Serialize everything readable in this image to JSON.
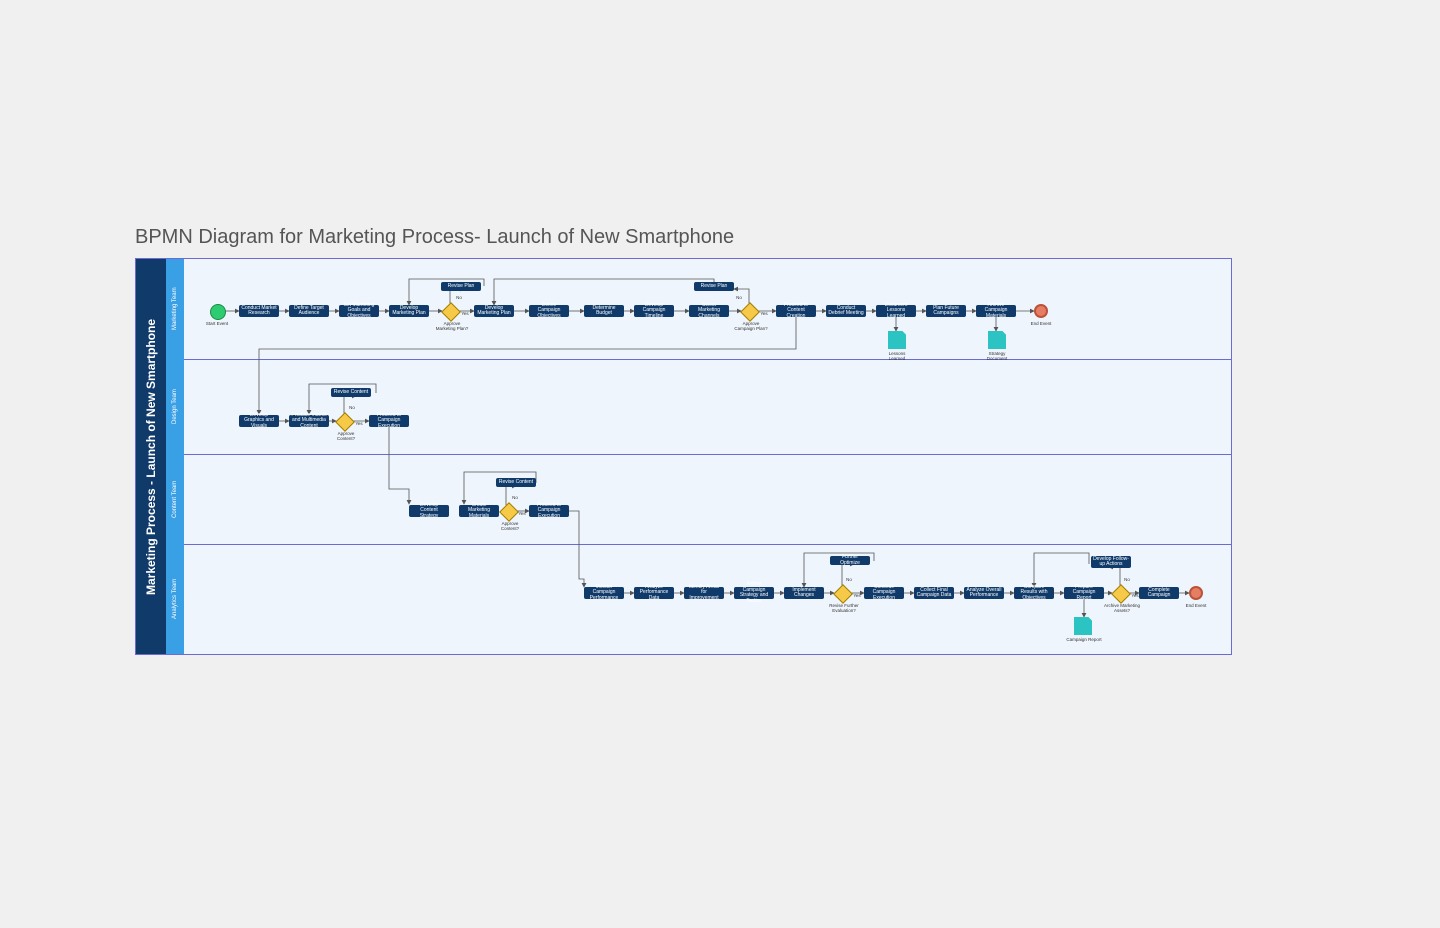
{
  "title": "BPMN Diagram for Marketing Process- Launch of New Smartphone",
  "pool_title": "Marketing Process - Launch of New Smartphone",
  "lanes": {
    "marketing": "Marketing Team",
    "design": "Design Team",
    "content": "Content Team",
    "analytics": "Analytics Team"
  },
  "events": {
    "start": "Start Event",
    "end1": "End Event",
    "end2": "End Event"
  },
  "tasks": {
    "m1": "Conduct Market Research",
    "m2": "Define Target Audience",
    "m3": "Set Marketing Goals and Objectives",
    "m4": "Develop Marketing Plan",
    "m5": "Develop Marketing Plan",
    "m6": "Define Campaign Objectives",
    "m7": "Determine Budget",
    "m8": "Develop Campaign Timeline",
    "m9": "Select Marketing Channels",
    "m10": "Proceed to Content Creation",
    "m11": "Conduct Debrief Meeting",
    "m12": "Document Lessons Learned",
    "m13": "Plan Future Campaigns",
    "m14": "Archive Campaign Materials",
    "m1b": "Revise Plan",
    "m9b": "Revise Plan",
    "d1": "Develop Graphics and Visuals",
    "d2": "Produce Videos and Multimedia Content",
    "d3": "Proceed to Campaign Execution",
    "d1b": "Revise Content",
    "c1": "Develop Content Strategy",
    "c2": "Create Marketing Materials",
    "c3": "Proceed to Campaign Execution",
    "c1b": "Revise Content",
    "a1": "Monitor Campaign Performance",
    "a2": "Analyze Performance Data",
    "a3": "Identify Areas for Improvement",
    "a4": "Refine Campaign Strategy and Tactics",
    "a5": "Implement Changes",
    "a6": "Continue Campaign Execution",
    "a7": "Collect Final Campaign Data",
    "a8": "Analyze Overall Performance",
    "a9": "Compare Results with Objectives",
    "a10": "Prepare Campaign Report",
    "a11": "Complete Campaign",
    "a5b": "Further Optimize",
    "a10b": "Develop Follow-up Actions"
  },
  "gateway_labels": {
    "g1": "Approve Marketing Plan?",
    "g2": "Approve Campaign Plan?",
    "g3": "Approve Content?",
    "g4": "Approve Content?",
    "g5": "Revise Further Evaluation?",
    "g6": "Archive Marketing Assets?"
  },
  "path_labels": {
    "yes": "Yes",
    "no": "No"
  },
  "docs": {
    "d1": "Lessons Learned",
    "d2": "Strategy Document",
    "d3": "Campaign Report"
  }
}
